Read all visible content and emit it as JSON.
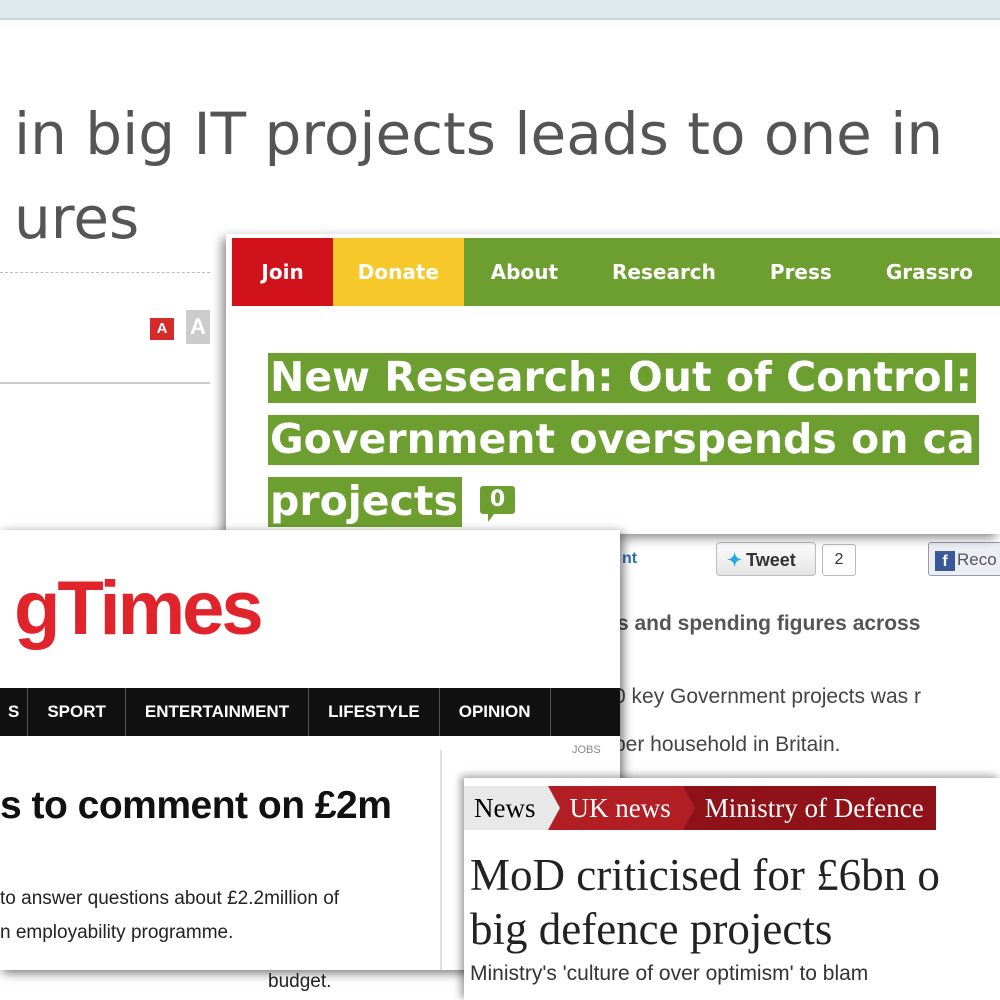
{
  "clip_research_article": {
    "headline_line1": "in big IT projects leads to one in",
    "headline_line2": "ures",
    "font_controls": {
      "small": "A",
      "large": "A"
    }
  },
  "clip_campaign_site": {
    "nav": [
      "Join",
      "Donate",
      "About",
      "Research",
      "Press",
      "Grassro"
    ],
    "title_line1": "New Research: Out of Control:",
    "title_line2": "Government overspends on ca",
    "title_line3": "projects",
    "comment_count": "0",
    "comment_link": "nt",
    "tweet_label": "Tweet",
    "tweet_count": "2",
    "facebook_label": "Reco",
    "subheading": "ts and spending figures across",
    "body_line1": "0 key Government projects was r",
    "body_line2": "per household in Britain."
  },
  "clip_tabloid": {
    "masthead": "gTimes",
    "nav": [
      "S",
      "SPORT",
      "ENTERTAINMENT",
      "LIFESTYLE",
      "OPINION"
    ],
    "jobs_label": "JOBS",
    "headline": "s to comment on £2m",
    "body_line1": "to answer questions about £2.2million of",
    "body_line2": "n employability programme.",
    "body_peek": "budget."
  },
  "clip_broadsheet": {
    "breadcrumbs": [
      "News",
      "UK news",
      "Ministry of Defence"
    ],
    "headline_line1": "MoD criticised for £6bn o",
    "headline_line2": "big defence projects",
    "standfirst": "Ministry's 'culture of over optimism' to blam"
  },
  "colors": {
    "join_red": "#d0121b",
    "donate_yellow": "#f7c82a",
    "campaign_green": "#6c9f2f",
    "tabloid_red": "#e1242b",
    "broadsheet_red": "#b11e24",
    "broadsheet_dark_red": "#8e1217"
  },
  "icons": [
    "twitter-bird-icon",
    "facebook-icon",
    "comment-bubble-icon"
  ]
}
